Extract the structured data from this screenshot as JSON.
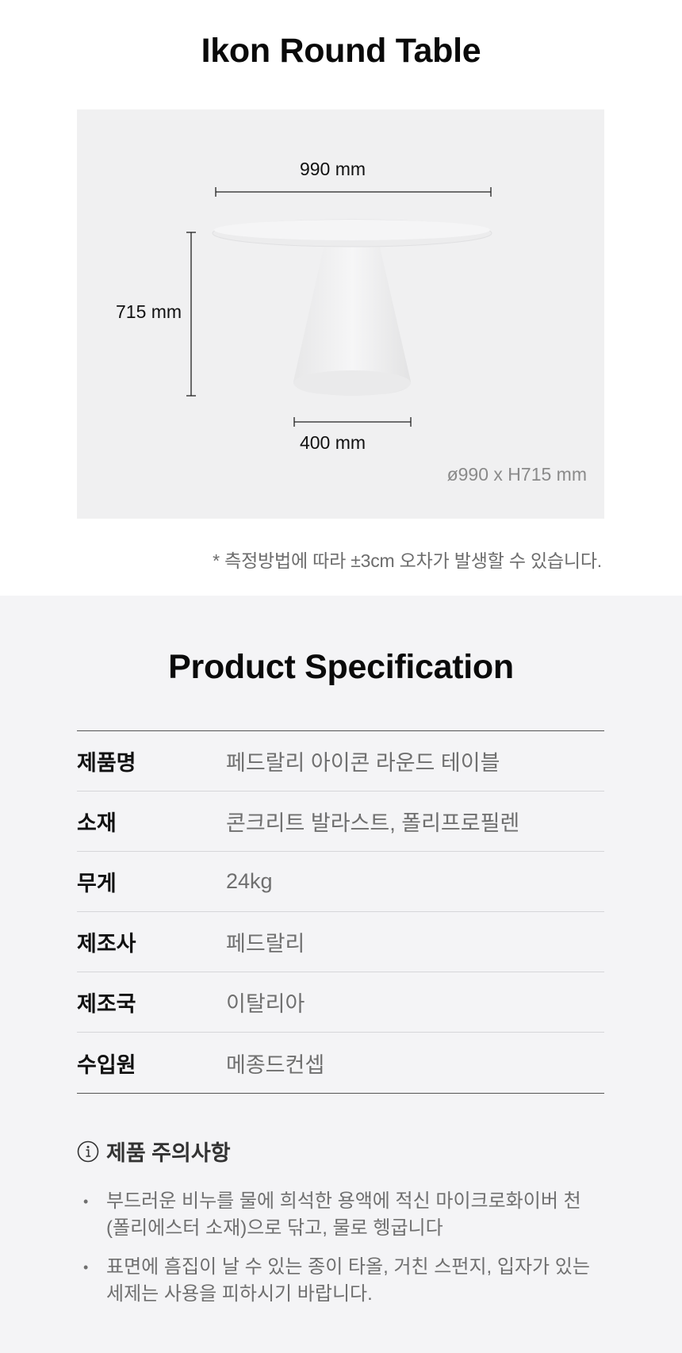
{
  "product": {
    "title": "Ikon Round Table",
    "dimensions": {
      "width_label": "990 mm",
      "height_label": "715 mm",
      "base_label": "400 mm",
      "summary": "ø990 x H715 mm"
    },
    "note": "* 측정방법에 따라 ±3cm 오차가 발생할 수 있습니다."
  },
  "specification": {
    "title": "Product Specification",
    "rows": [
      {
        "key": "제품명",
        "value": "페드랄리 아이콘 라운드 테이블"
      },
      {
        "key": "소재",
        "value": "콘크리트 발라스트, 폴리프로필렌"
      },
      {
        "key": "무게",
        "value": "24kg"
      },
      {
        "key": "제조사",
        "value": "페드랄리"
      },
      {
        "key": "제조국",
        "value": "이탈리아"
      },
      {
        "key": "수입원",
        "value": "메종드컨셉"
      }
    ]
  },
  "caution": {
    "icon": "info-icon",
    "title": "제품 주의사항",
    "items": [
      "부드러운 비누를 물에 희석한 용액에 적신 마이크로화이버 천 (폴리에스터 소재)으로 닦고, 물로 헹굽니다",
      "표면에 흠집이 날 수 있는 종이 타올, 거친 스펀지, 입자가 있는 세제는 사용을 피하시기 바랍니다."
    ]
  }
}
